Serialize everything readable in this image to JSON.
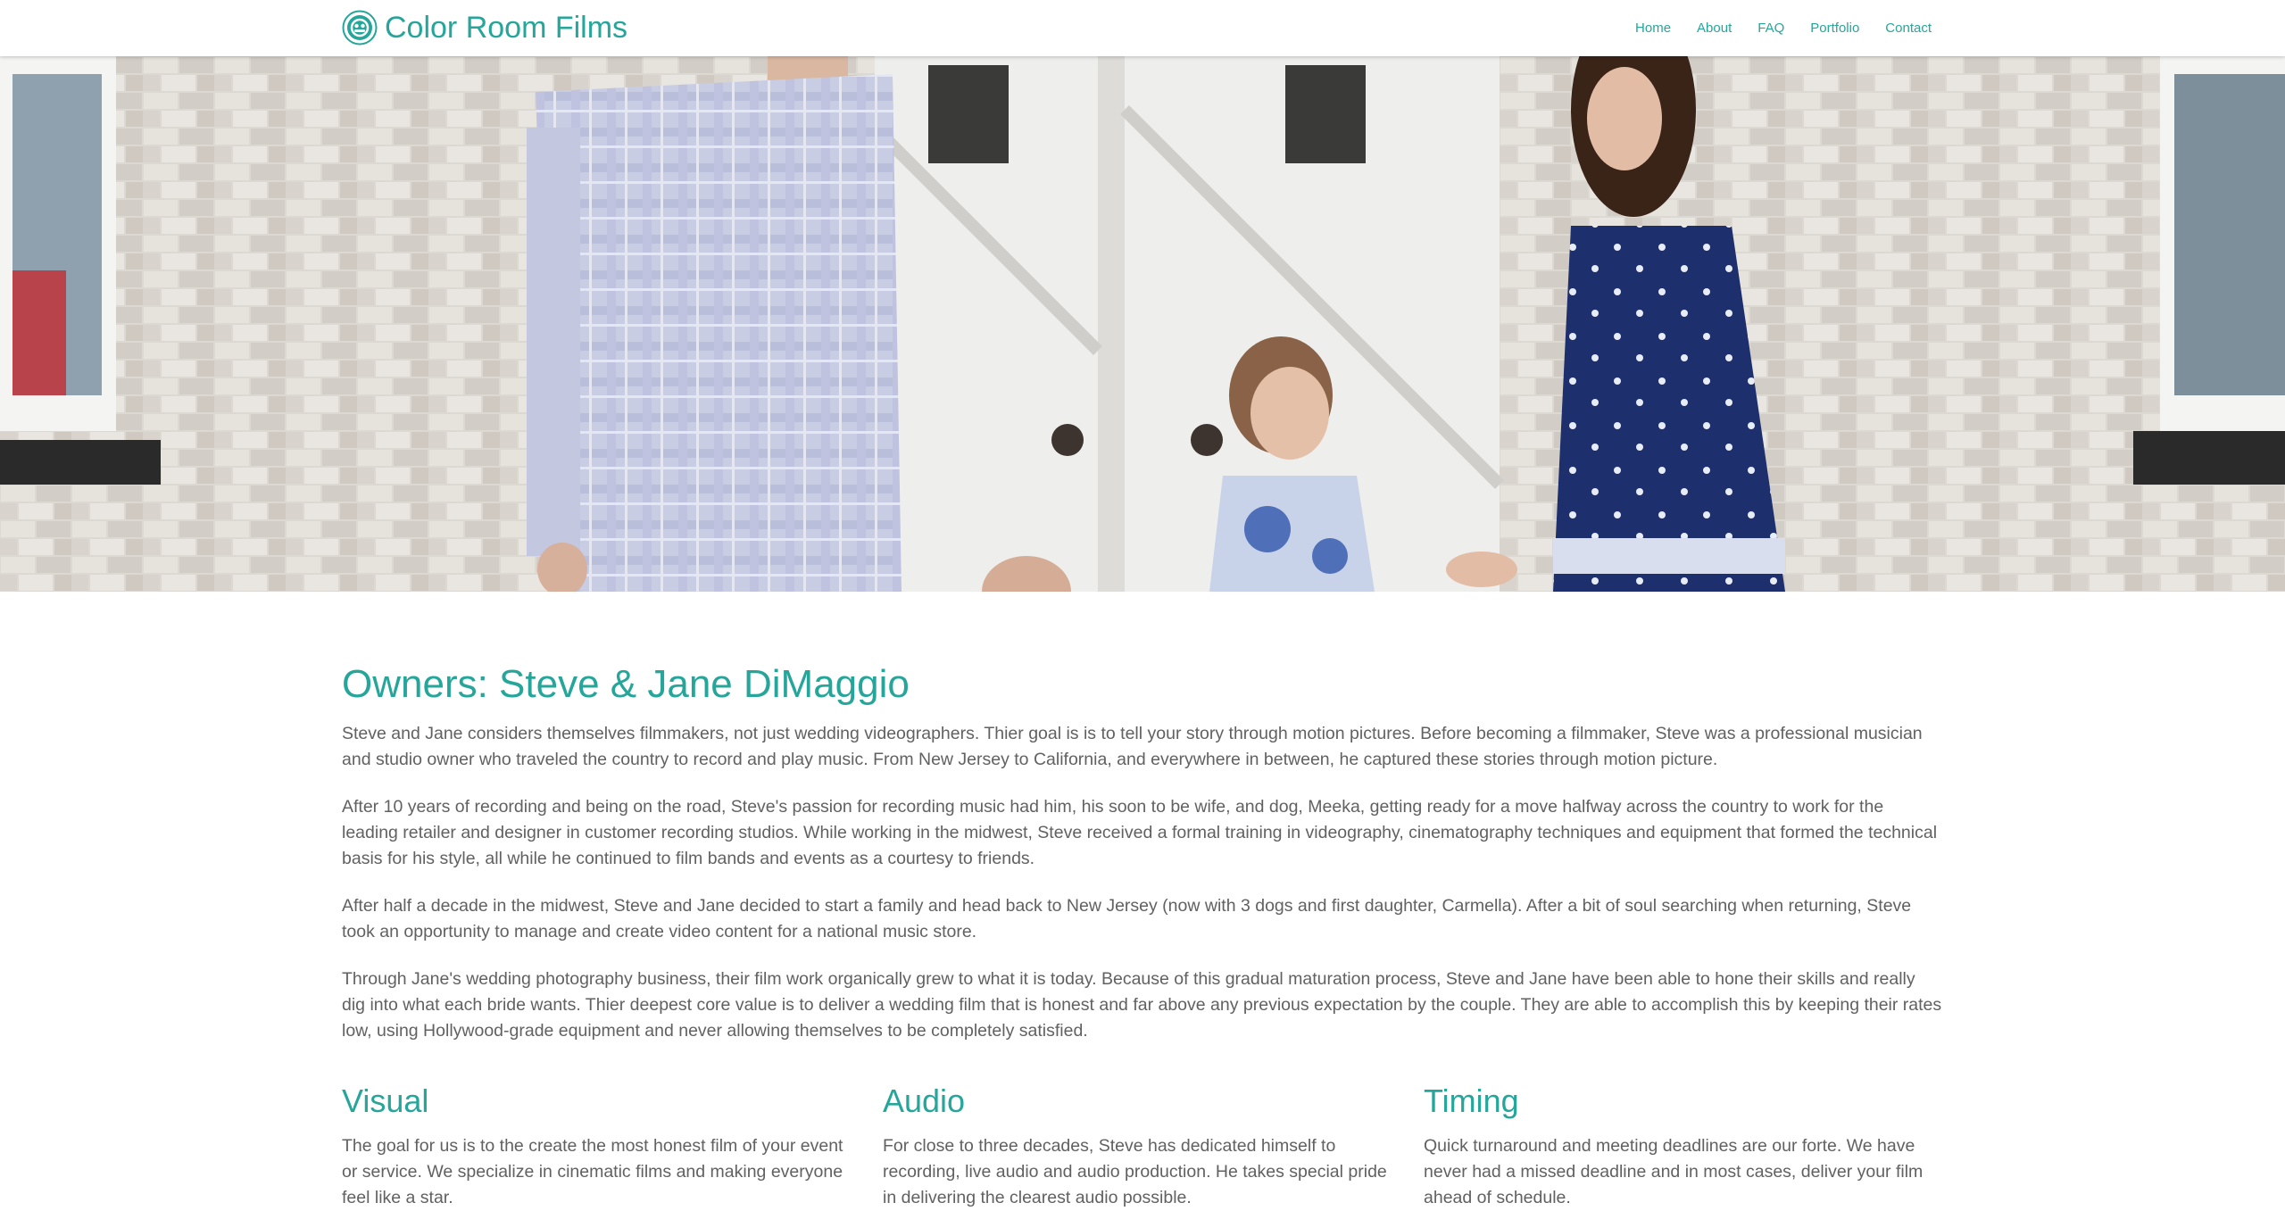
{
  "colors": {
    "accent": "#26a69a",
    "body_text": "#616161"
  },
  "nav": {
    "brand": "Color Room Films",
    "logo_icon": "film-reel-logo-icon",
    "links": [
      "Home",
      "About",
      "FAQ",
      "Portfolio",
      "Contact"
    ]
  },
  "hero": {
    "image": "family-photo-couple-with-two-daughters-in-front-of-white-brick-wall"
  },
  "about": {
    "title": "Owners: Steve & Jane DiMaggio",
    "paragraphs": [
      "Steve and Jane considers themselves filmmakers, not just wedding videographers. Thier goal is is to tell your story through motion pictures. Before becoming a filmmaker, Steve was a professional musician and studio owner who traveled the country to record and play music. From New Jersey to California, and everywhere in between, he captured these stories through motion picture.",
      "After 10 years of recording and being on the road, Steve's passion for recording music had him, his soon to be wife, and dog, Meeka, getting ready for a move halfway across the country to work for the leading retailer and designer in customer recording studios. While working in the midwest, Steve received a formal training in videography, cinematography techniques and equipment that formed the technical basis for his style, all while he continued to film bands and events as a courtesy to friends.",
      "After half a decade in the midwest, Steve and Jane decided to start a family and head back to New Jersey (now with 3 dogs and first daughter, Carmella). After a bit of soul searching when returning, Steve took an opportunity to manage and create video content for a national music store.",
      "Through Jane's wedding photography business, their film work organically grew to what it is today. Because of this gradual maturation process, Steve and Jane have been able to hone their skills and really dig into what each bride wants. Thier deepest core value is to deliver a wedding film that is honest and far above any previous expectation by the couple. They are able to accomplish this by keeping their rates low, using Hollywood-grade equipment and never allowing themselves to be completely satisfied."
    ]
  },
  "features": [
    {
      "title": "Visual",
      "text": "The goal for us is to the create the most honest film of your event or service. We specialize in cinematic films and making everyone feel like a star."
    },
    {
      "title": "Audio",
      "text": "For close to three decades, Steve has dedicated himself to recording, live audio and audio production. He takes special pride in delivering the clearest audio possible."
    },
    {
      "title": "Timing",
      "text": "Quick turnaround and meeting deadlines are our forte. We have never had a missed deadline and in most cases, deliver your film ahead of schedule."
    }
  ]
}
